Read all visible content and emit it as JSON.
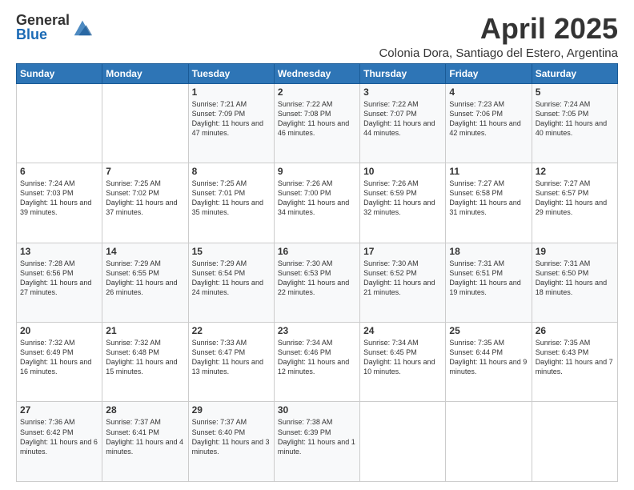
{
  "logo": {
    "general": "General",
    "blue": "Blue"
  },
  "header": {
    "month_year": "April 2025",
    "subtitle": "Colonia Dora, Santiago del Estero, Argentina"
  },
  "days_of_week": [
    "Sunday",
    "Monday",
    "Tuesday",
    "Wednesday",
    "Thursday",
    "Friday",
    "Saturday"
  ],
  "weeks": [
    [
      {
        "day": "",
        "text": ""
      },
      {
        "day": "",
        "text": ""
      },
      {
        "day": "1",
        "text": "Sunrise: 7:21 AM\nSunset: 7:09 PM\nDaylight: 11 hours and 47 minutes."
      },
      {
        "day": "2",
        "text": "Sunrise: 7:22 AM\nSunset: 7:08 PM\nDaylight: 11 hours and 46 minutes."
      },
      {
        "day": "3",
        "text": "Sunrise: 7:22 AM\nSunset: 7:07 PM\nDaylight: 11 hours and 44 minutes."
      },
      {
        "day": "4",
        "text": "Sunrise: 7:23 AM\nSunset: 7:06 PM\nDaylight: 11 hours and 42 minutes."
      },
      {
        "day": "5",
        "text": "Sunrise: 7:24 AM\nSunset: 7:05 PM\nDaylight: 11 hours and 40 minutes."
      }
    ],
    [
      {
        "day": "6",
        "text": "Sunrise: 7:24 AM\nSunset: 7:03 PM\nDaylight: 11 hours and 39 minutes."
      },
      {
        "day": "7",
        "text": "Sunrise: 7:25 AM\nSunset: 7:02 PM\nDaylight: 11 hours and 37 minutes."
      },
      {
        "day": "8",
        "text": "Sunrise: 7:25 AM\nSunset: 7:01 PM\nDaylight: 11 hours and 35 minutes."
      },
      {
        "day": "9",
        "text": "Sunrise: 7:26 AM\nSunset: 7:00 PM\nDaylight: 11 hours and 34 minutes."
      },
      {
        "day": "10",
        "text": "Sunrise: 7:26 AM\nSunset: 6:59 PM\nDaylight: 11 hours and 32 minutes."
      },
      {
        "day": "11",
        "text": "Sunrise: 7:27 AM\nSunset: 6:58 PM\nDaylight: 11 hours and 31 minutes."
      },
      {
        "day": "12",
        "text": "Sunrise: 7:27 AM\nSunset: 6:57 PM\nDaylight: 11 hours and 29 minutes."
      }
    ],
    [
      {
        "day": "13",
        "text": "Sunrise: 7:28 AM\nSunset: 6:56 PM\nDaylight: 11 hours and 27 minutes."
      },
      {
        "day": "14",
        "text": "Sunrise: 7:29 AM\nSunset: 6:55 PM\nDaylight: 11 hours and 26 minutes."
      },
      {
        "day": "15",
        "text": "Sunrise: 7:29 AM\nSunset: 6:54 PM\nDaylight: 11 hours and 24 minutes."
      },
      {
        "day": "16",
        "text": "Sunrise: 7:30 AM\nSunset: 6:53 PM\nDaylight: 11 hours and 22 minutes."
      },
      {
        "day": "17",
        "text": "Sunrise: 7:30 AM\nSunset: 6:52 PM\nDaylight: 11 hours and 21 minutes."
      },
      {
        "day": "18",
        "text": "Sunrise: 7:31 AM\nSunset: 6:51 PM\nDaylight: 11 hours and 19 minutes."
      },
      {
        "day": "19",
        "text": "Sunrise: 7:31 AM\nSunset: 6:50 PM\nDaylight: 11 hours and 18 minutes."
      }
    ],
    [
      {
        "day": "20",
        "text": "Sunrise: 7:32 AM\nSunset: 6:49 PM\nDaylight: 11 hours and 16 minutes."
      },
      {
        "day": "21",
        "text": "Sunrise: 7:32 AM\nSunset: 6:48 PM\nDaylight: 11 hours and 15 minutes."
      },
      {
        "day": "22",
        "text": "Sunrise: 7:33 AM\nSunset: 6:47 PM\nDaylight: 11 hours and 13 minutes."
      },
      {
        "day": "23",
        "text": "Sunrise: 7:34 AM\nSunset: 6:46 PM\nDaylight: 11 hours and 12 minutes."
      },
      {
        "day": "24",
        "text": "Sunrise: 7:34 AM\nSunset: 6:45 PM\nDaylight: 11 hours and 10 minutes."
      },
      {
        "day": "25",
        "text": "Sunrise: 7:35 AM\nSunset: 6:44 PM\nDaylight: 11 hours and 9 minutes."
      },
      {
        "day": "26",
        "text": "Sunrise: 7:35 AM\nSunset: 6:43 PM\nDaylight: 11 hours and 7 minutes."
      }
    ],
    [
      {
        "day": "27",
        "text": "Sunrise: 7:36 AM\nSunset: 6:42 PM\nDaylight: 11 hours and 6 minutes."
      },
      {
        "day": "28",
        "text": "Sunrise: 7:37 AM\nSunset: 6:41 PM\nDaylight: 11 hours and 4 minutes."
      },
      {
        "day": "29",
        "text": "Sunrise: 7:37 AM\nSunset: 6:40 PM\nDaylight: 11 hours and 3 minutes."
      },
      {
        "day": "30",
        "text": "Sunrise: 7:38 AM\nSunset: 6:39 PM\nDaylight: 11 hours and 1 minute."
      },
      {
        "day": "",
        "text": ""
      },
      {
        "day": "",
        "text": ""
      },
      {
        "day": "",
        "text": ""
      }
    ]
  ]
}
